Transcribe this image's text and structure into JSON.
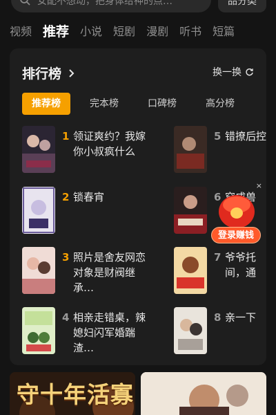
{
  "search": {
    "placeholder": "女配不想动，把身体给神的点…",
    "category_label": "品分类"
  },
  "top_tabs": [
    "视频",
    "推荐",
    "小说",
    "短剧",
    "漫剧",
    "听书",
    "短篇"
  ],
  "rank": {
    "title": "排行榜",
    "refresh_label": "换一换",
    "sub_tabs": [
      "推荐榜",
      "完本榜",
      "口碑榜",
      "高分榜"
    ],
    "books": [
      {
        "num": "1",
        "title": "领证爽约？我嫁你小叔疯什么"
      },
      {
        "num": "2",
        "title": "锁春宵"
      },
      {
        "num": "3",
        "title": "照片是舍友网恋对象是财阀继承…"
      },
      {
        "num": "4",
        "title": "相亲走错桌，辣媳妇闪军婚踹渣…"
      },
      {
        "num": "5",
        "title": "错撩后控"
      },
      {
        "num": "6",
        "title": "穿成兽"
      },
      {
        "num": "7",
        "title": "爷爷托间，通"
      },
      {
        "num": "8",
        "title": "亲一下"
      }
    ]
  },
  "reward": {
    "label": "登录赚钱",
    "close": "×"
  },
  "banners": {
    "left_text": "守十年活寡"
  },
  "colors": {
    "accent": "#f6a000",
    "rank_top": "#f6a000",
    "rank_other": "#9a9a9a"
  }
}
